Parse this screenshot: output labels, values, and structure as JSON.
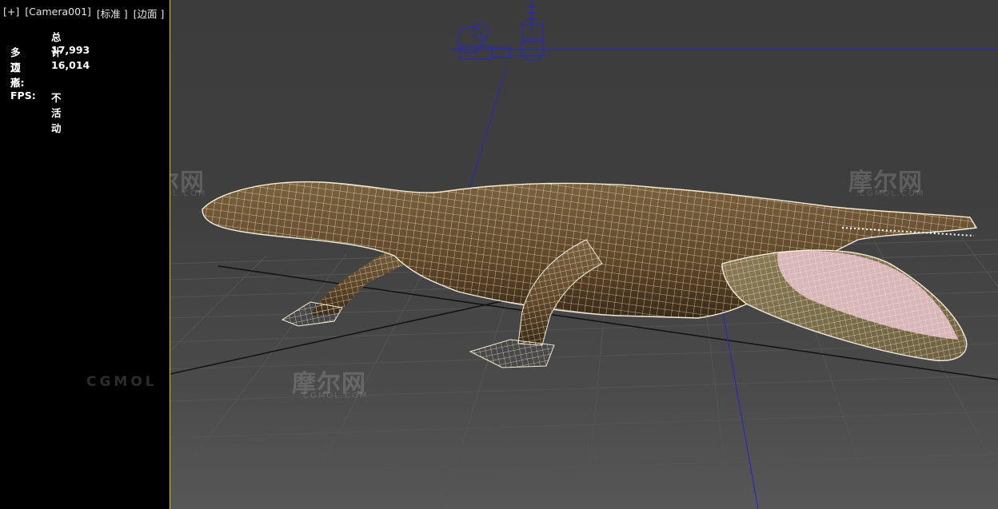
{
  "viewport": {
    "plus_label": "[+]",
    "camera_label": "[Camera001]",
    "shading_label": "[标准 ]",
    "edges_label": "[边面 ]"
  },
  "stats": {
    "header": "总计",
    "polygons_label": "多边形:",
    "polygons_value": "17,993",
    "vertices_label": "顶点:",
    "vertices_value": "16,014",
    "fps_label": "FPS:",
    "fps_value": "不活动"
  },
  "watermarks": {
    "brand": "摩尔网",
    "domain": "CGMOL.COM",
    "short": "CGMOL"
  },
  "colors": {
    "background_top": "#3c3c3c",
    "background_bottom": "#575757",
    "safe_frame": "#c8d400",
    "gizmo_blue": "#2a2ab8",
    "mesh_fill": "#6b5232",
    "wireframe": "#f4ecd8"
  }
}
